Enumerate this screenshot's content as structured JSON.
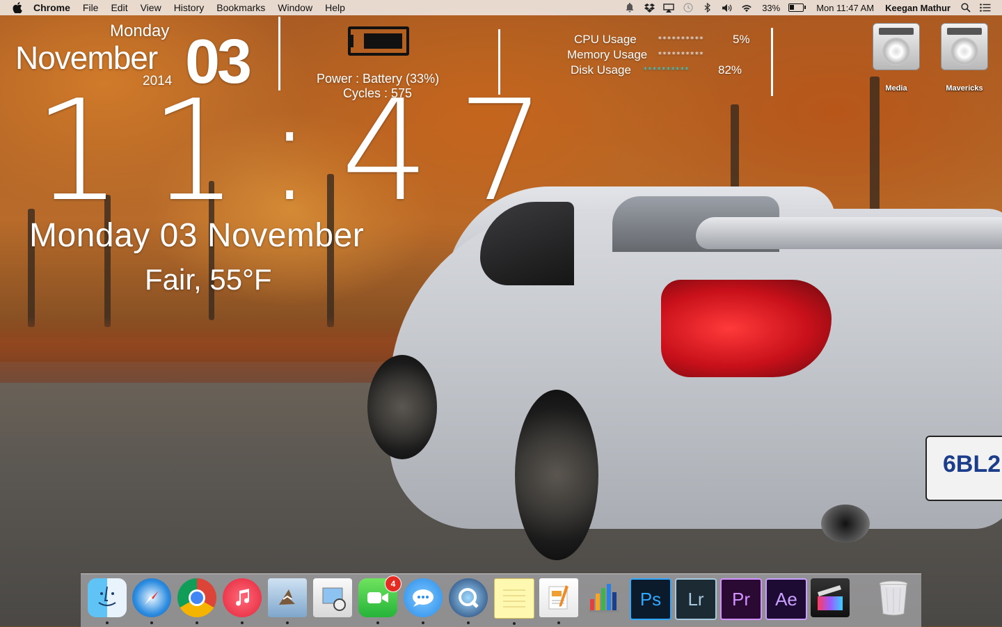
{
  "menubar": {
    "app_name": "Chrome",
    "menus": [
      "File",
      "Edit",
      "View",
      "History",
      "Bookmarks",
      "Window",
      "Help"
    ],
    "battery_percent": "33%",
    "clock": "Mon 11:47 AM",
    "user": "Keegan Mathur"
  },
  "widgets": {
    "date": {
      "day": "Monday",
      "month": "November",
      "year": "2014",
      "day_num": "03"
    },
    "battery": {
      "power": "Power : Battery (33%)",
      "cycles": "Cycles : 575",
      "level": 0.33
    },
    "stats": [
      {
        "label": "CPU Usage",
        "bar": "**********",
        "value": "5%"
      },
      {
        "label": "Memory Usage",
        "bar": "**********",
        "value": ""
      },
      {
        "label": "Disk Usage",
        "bar": "**********",
        "value": "82%"
      }
    ],
    "clock": "11:47",
    "long_date": "Monday 03 November",
    "weather": "Fair, 55°F"
  },
  "desktop": {
    "drives": [
      {
        "label": "Media"
      },
      {
        "label": "Mavericks"
      }
    ]
  },
  "dock": {
    "apps": [
      {
        "name": "finder-icon"
      },
      {
        "name": "safari-icon"
      },
      {
        "name": "chrome-icon"
      },
      {
        "name": "itunes-icon"
      },
      {
        "name": "mail-icon"
      },
      {
        "name": "preview-icon"
      },
      {
        "name": "facetime-icon",
        "badge": "4"
      },
      {
        "name": "messages-icon"
      },
      {
        "name": "quicktime-icon"
      },
      {
        "name": "notes-icon"
      },
      {
        "name": "pages-icon"
      },
      {
        "name": "numbers-icon"
      },
      {
        "name": "photoshop-icon",
        "label": "Ps"
      },
      {
        "name": "lightroom-icon",
        "label": "Lr"
      },
      {
        "name": "premiere-icon",
        "label": "Pr"
      },
      {
        "name": "aftereffects-icon",
        "label": "Ae"
      },
      {
        "name": "finalcut-icon"
      },
      {
        "name": "trash-icon"
      }
    ]
  },
  "colors": {
    "menubar_bg": "#f0ebe6",
    "dock_bg": "#c8c8cd",
    "badge": "#e52a21"
  }
}
